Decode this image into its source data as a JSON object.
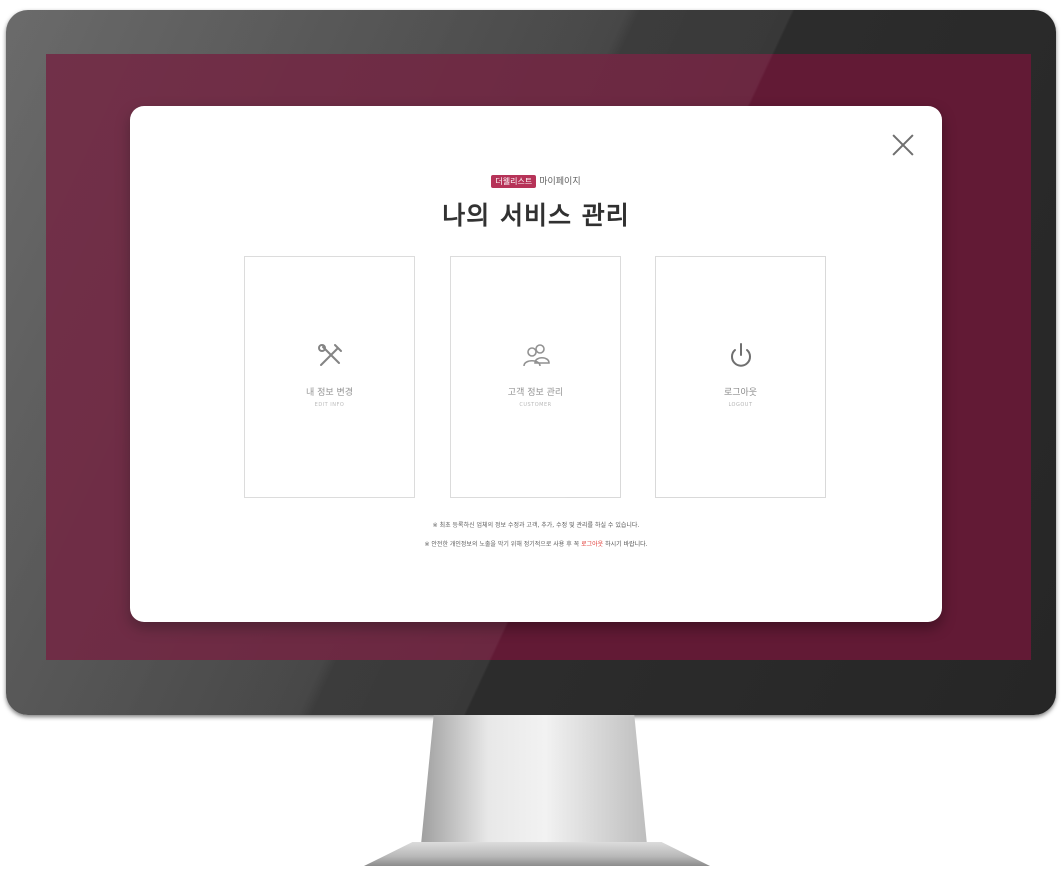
{
  "modal": {
    "brand_badge": "더웰리스트",
    "brand_suffix": "마이페이지",
    "title": "나의 서비스 관리"
  },
  "cards": [
    {
      "label": "내 정보 변경",
      "sub": "EDIT INFO",
      "icon": "tools-icon"
    },
    {
      "label": "고객 정보 관리",
      "sub": "CUSTOMER",
      "icon": "users-icon"
    },
    {
      "label": "로그아웃",
      "sub": "LOGOUT",
      "icon": "power-icon"
    }
  ],
  "notes": {
    "line1": "※ 최초 등록하신 업체의 정보 수정과 고객, 추가, 수정 및 관리를 하실 수 있습니다.",
    "line2_prefix": "※ 안전한 개인정보의 노출을 막기 위해 정기적으로 사용 후 꼭 ",
    "line2_highlight": "로그아웃",
    "line2_suffix": " 하시기 바랍니다."
  },
  "colors": {
    "screen_background": "#621a35",
    "brand_accent": "#b1244c",
    "highlight": "#e0342f"
  }
}
